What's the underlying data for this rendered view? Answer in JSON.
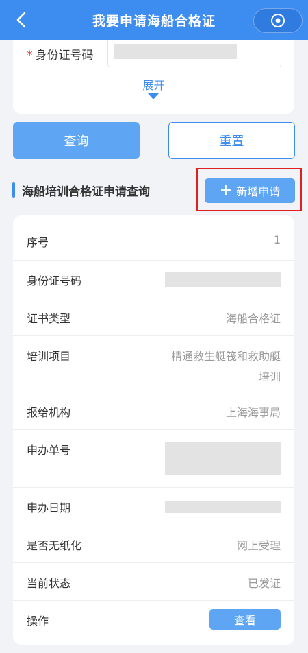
{
  "header": {
    "title": "我要申请海船合格证",
    "back_icon": "chevron-left-icon",
    "capsule_icon": "record-icon"
  },
  "form": {
    "required_mark": "*",
    "id_label": "身份证号码",
    "expand_label": "展开"
  },
  "buttons": {
    "query": "查询",
    "reset": "重置",
    "add_plus": "+",
    "add": "新增申请",
    "view": "查看"
  },
  "section": {
    "title": "海船培训合格证申请查询"
  },
  "details": {
    "seq_label": "序号",
    "seq_value": "1",
    "id_label": "身份证号码",
    "cert_type_label": "证书类型",
    "cert_type_value": "海船合格证",
    "training_label": "培训项目",
    "training_value_line1": "精通救生艇筏和救助艇",
    "training_value_line2": "培训",
    "issuer_label": "报给机构",
    "issuer_value": "上海海事局",
    "app_no_label": "申办单号",
    "app_date_label": "申办日期",
    "paperless_label": "是否无纸化",
    "paperless_value": "网上受理",
    "status_label": "当前状态",
    "status_value": "已发证",
    "action_label": "操作"
  },
  "colors": {
    "primary": "#3d8cf0",
    "button_fill": "#5ea6f3",
    "required": "#e33333",
    "highlight": "#e02020"
  }
}
